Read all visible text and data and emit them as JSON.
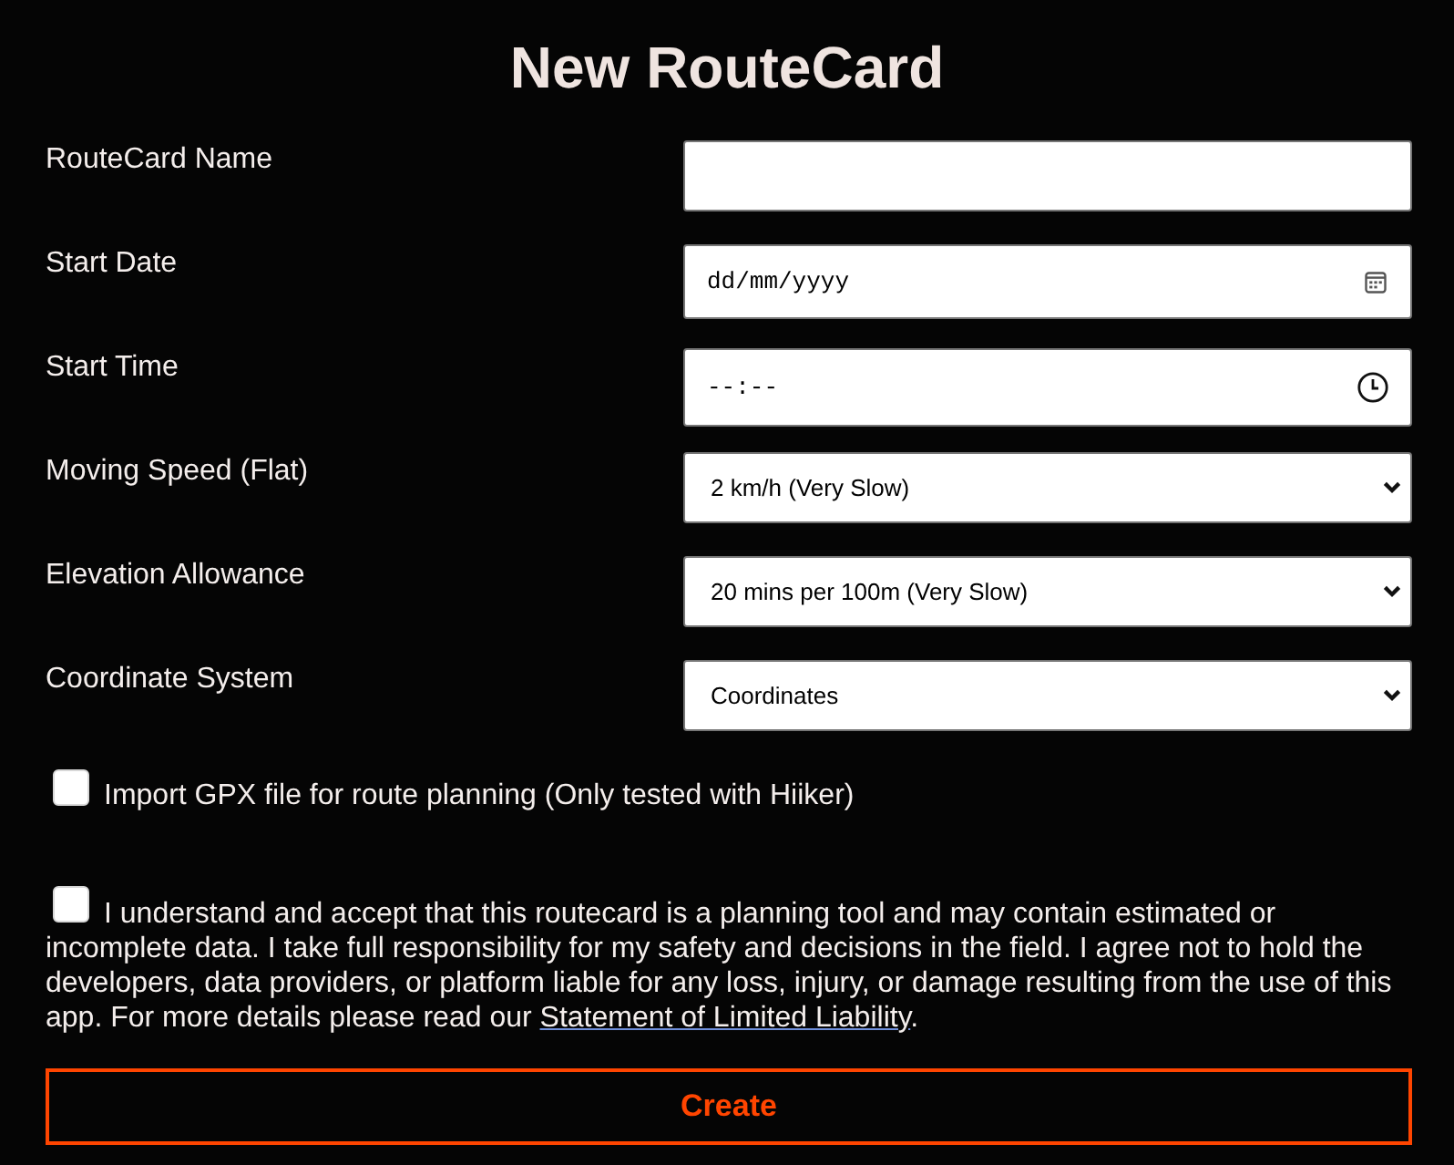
{
  "title": "New RouteCard",
  "fields": [
    {
      "label": "RouteCard Name",
      "kind": "text"
    },
    {
      "label": "Start Date",
      "kind": "date",
      "placeholder": "dd/mm/yyyy"
    },
    {
      "label": "Start Time",
      "kind": "time",
      "placeholder": "--:--"
    },
    {
      "label": "Moving Speed (Flat)",
      "kind": "select",
      "value": "2 km/h (Very Slow)"
    },
    {
      "label": "Elevation Allowance",
      "kind": "select",
      "value": "20 mins per 100m (Very Slow)"
    },
    {
      "label": "Coordinate System",
      "kind": "select",
      "value": "Coordinates"
    }
  ],
  "options": [
    {
      "label": "Import GPX file for route planning (Only tested with Hiiker)",
      "checked": false
    }
  ],
  "agreement": {
    "checked": false,
    "text": "I understand and accept that this routecard is a planning tool and may contain estimated or incomplete data. I take full responsibility for my safety and decisions in the field. I agree not to hold the developers, data providers, or platform liable for any loss, injury, or damage resulting from the use of this app. For more details please read our",
    "link": "Statement of Limited Liability",
    "text_after": "."
  },
  "submit": {
    "label": "Create"
  }
}
